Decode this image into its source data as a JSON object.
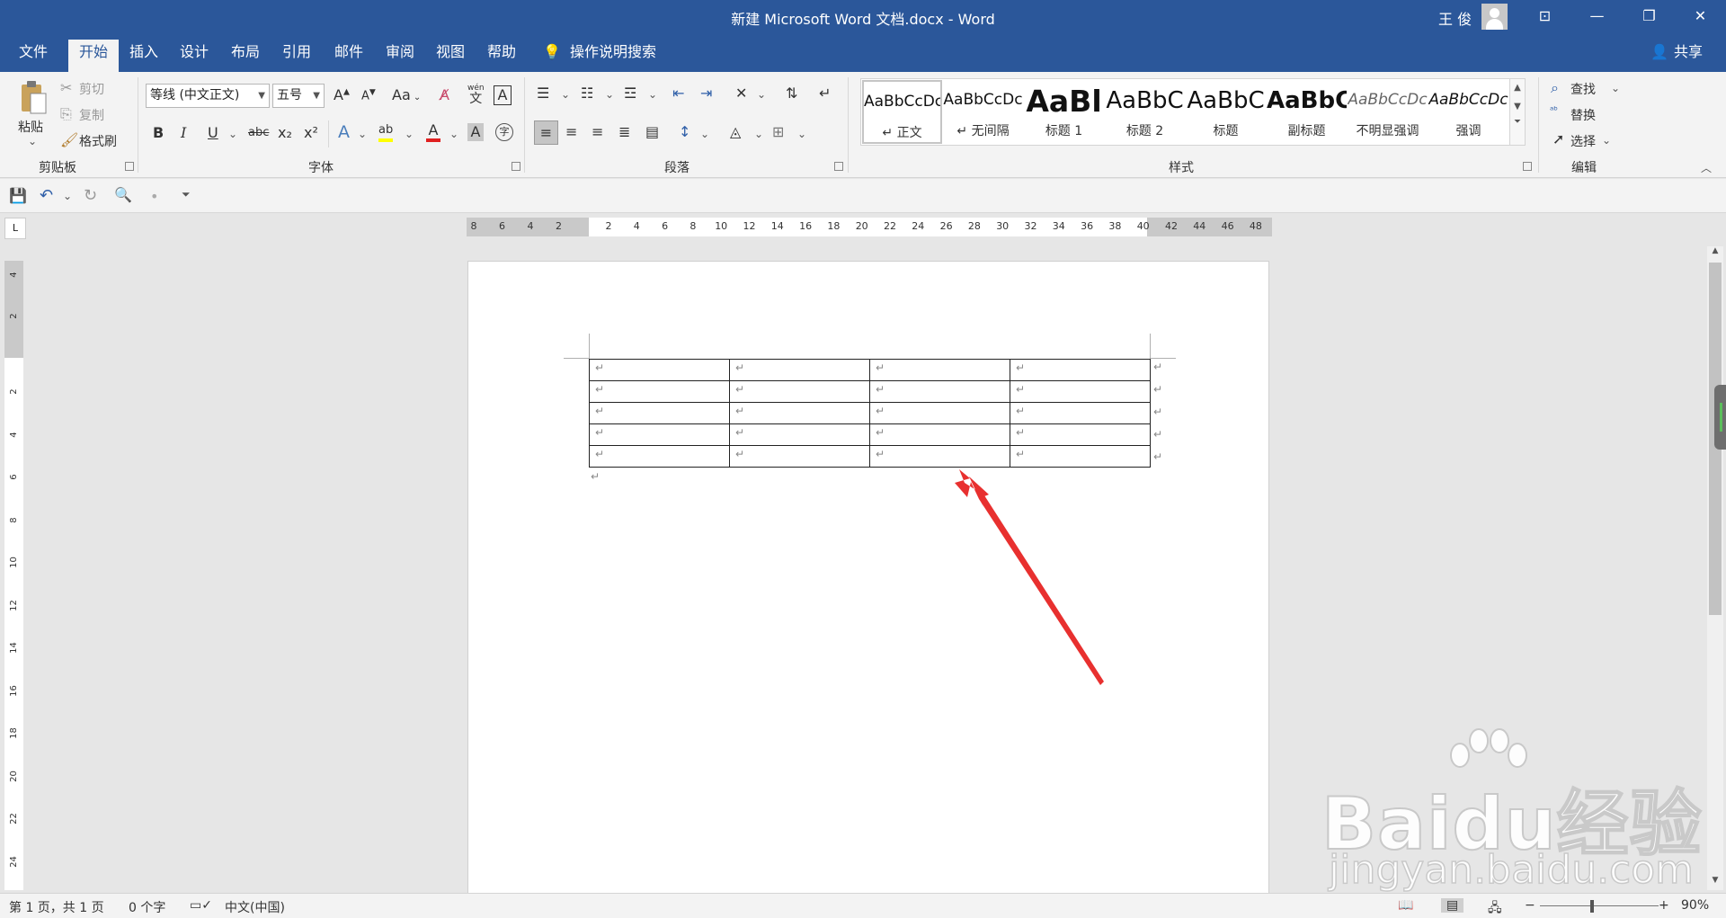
{
  "window": {
    "title": "新建 Microsoft Word 文档.docx  -  Word",
    "user": "王 俊"
  },
  "tabs": [
    "文件",
    "开始",
    "插入",
    "设计",
    "布局",
    "引用",
    "邮件",
    "审阅",
    "视图",
    "帮助"
  ],
  "tell_me": "操作说明搜索",
  "share": "共享",
  "clipboard": {
    "paste": "粘贴",
    "cut": "剪切",
    "copy": "复制",
    "format_painter": "格式刷",
    "label": "剪贴板"
  },
  "font": {
    "name": "等线 (中文正文)",
    "size": "五号",
    "label": "字体",
    "bold": "B",
    "italic": "I",
    "underline": "U",
    "strike": "abc",
    "sub": "x₂",
    "sup": "x²",
    "case": "Aa",
    "grow": "A",
    "shrink": "A",
    "wen": "wén",
    "wen_char": "文",
    "border_char": "A",
    "font_color_char": "A",
    "shade_char": "A",
    "enclose_char": "字",
    "highlight_char": "ab",
    "effects_char": "A"
  },
  "paragraph": {
    "label": "段落"
  },
  "styles": {
    "label": "样式",
    "items": [
      {
        "preview": "AaBbCcDc",
        "name": "↵ 正文"
      },
      {
        "preview": "AaBbCcDc",
        "name": "↵ 无间隔"
      },
      {
        "preview": "AaBl",
        "name": "标题 1"
      },
      {
        "preview": "AaBbC",
        "name": "标题 2"
      },
      {
        "preview": "AaBbC",
        "name": "标题"
      },
      {
        "preview": "AaBbC",
        "name": "副标题"
      },
      {
        "preview": "AaBbCcDc",
        "name": "不明显强调"
      },
      {
        "preview": "AaBbCcDc",
        "name": "强调"
      }
    ]
  },
  "editing": {
    "find": "查找",
    "replace": "替换",
    "select": "选择",
    "label": "编辑"
  },
  "ruler": {
    "corner": "L",
    "h_ticks": [
      "8",
      "6",
      "4",
      "2",
      "2",
      "4",
      "6",
      "8",
      "10",
      "12",
      "14",
      "16",
      "18",
      "20",
      "22",
      "24",
      "26",
      "28",
      "30",
      "32",
      "34",
      "36",
      "38",
      "40",
      "42",
      "44",
      "46",
      "48"
    ],
    "v_ticks": [
      "4",
      "2",
      "2",
      "4",
      "6",
      "8",
      "10",
      "12",
      "14",
      "16",
      "18",
      "20",
      "22",
      "24"
    ]
  },
  "document": {
    "mark": "↵",
    "rows": 5,
    "cols": 4
  },
  "watermark": {
    "logo": "Baidu经验",
    "url": "jingyan.baidu.com"
  },
  "status": {
    "page": "第 1 页，共 1 页",
    "words": "0 个字",
    "language": "中文(中国)",
    "zoom": "90%"
  }
}
